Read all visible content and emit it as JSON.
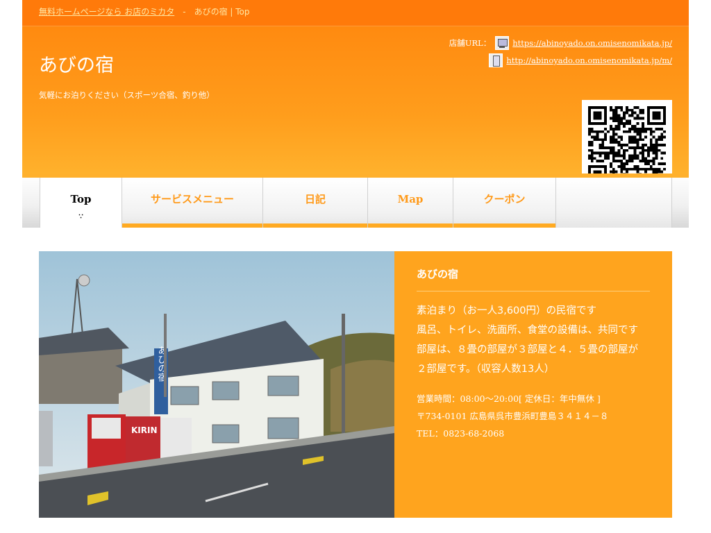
{
  "breadcrumb": {
    "home_link": "無料ホームページなら お店のミカタ",
    "separator": "-",
    "current": "あびの宿 | Top"
  },
  "header": {
    "site_title": "あびの宿",
    "tagline": "気軽にお泊りください（スポーツ合宿、釣り他）",
    "url_label": "店舗URL：",
    "pc_url": "https://abinoyado.on.omisenomikata.jp/",
    "mobile_url": "http://abinoyado.on.omisenomikata.jp/m/"
  },
  "nav": {
    "items": [
      {
        "label": "Top",
        "active": true
      },
      {
        "label": "サービスメニュー",
        "active": false
      },
      {
        "label": "日記",
        "active": false
      },
      {
        "label": "Map",
        "active": false
      },
      {
        "label": "クーポン",
        "active": false
      },
      {
        "label": "",
        "active": false
      }
    ],
    "active_marker": "∵"
  },
  "info": {
    "name": "あびの宿",
    "description": [
      "素泊まり（お一人3,600円）の民宿です",
      "風呂、トイレ、洗面所、食堂の設備は、共同です",
      "部屋は、８畳の部屋が３部屋と４．５畳の部屋が",
      "２部屋です。（収容人数13人）"
    ],
    "hours": "営業時間：08:00～20:00[ 定休日：年中無休 ]",
    "address": "〒734-0101 広島県呉市豊浜町豊島３４１４－８",
    "tel": "TEL：0823-68-2068"
  },
  "photo": {
    "sign_text": "あびの宿",
    "vending_brand": "KIRIN"
  },
  "colors": {
    "accent": "#ff9a1a",
    "header_orange": "#ff8a10",
    "info_bg": "#ffa41e"
  }
}
